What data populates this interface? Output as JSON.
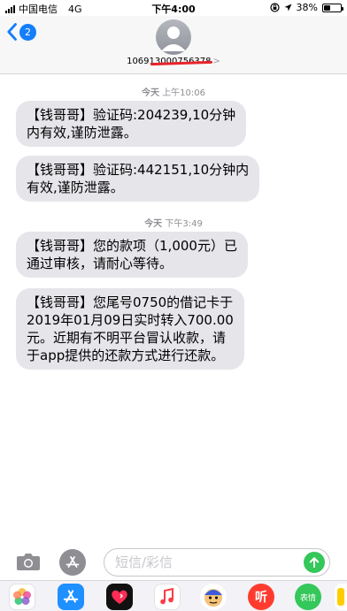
{
  "status_bar": {
    "carrier": "中国电信",
    "network": "4G",
    "time": "下午4:00",
    "battery_percent": "38%",
    "battery_level": 0.38
  },
  "header": {
    "back_badge": "2",
    "contact_number": "106913000756378",
    "chevron": ">"
  },
  "messages": [
    {
      "timestamp_day": "今天",
      "timestamp_time": "上午10:06"
    },
    {
      "text_lines": [
        "【钱哥哥】验证码:204239,10分钟",
        "内有效,谨防泄露。"
      ]
    },
    {
      "text_lines": [
        "【钱哥哥】验证码:442151,10分钟内",
        "有效,谨防泄露。"
      ]
    },
    {
      "timestamp_day": "今天",
      "timestamp_time": "下午3:49"
    },
    {
      "text_lines": [
        "【钱哥哥】您的款项（1,000元）已",
        "通过审核，请耐心等待。"
      ]
    },
    {
      "text_lines": [
        "【钱哥哥】您尾号0750的借记卡于",
        "2019年01月09日实时转入700.00",
        "元。近期有不明平台冒认收款，请",
        "于app提供的还款方式进行还款。"
      ]
    }
  ],
  "input_bar": {
    "placeholder": "短信/彩信",
    "value": ""
  },
  "app_drawer": {
    "apps": [
      "photos-app",
      "app-store",
      "heart-app",
      "music-app",
      "animoji",
      "ting-app",
      "emoji-app",
      "more-app"
    ],
    "labels": {
      "ting": "听",
      "emoji": "表情"
    }
  },
  "colors": {
    "accent": "#147efb",
    "bubble_gray": "#e5e5ea",
    "send_green": "#34c759",
    "redaction": "#e8232a"
  }
}
